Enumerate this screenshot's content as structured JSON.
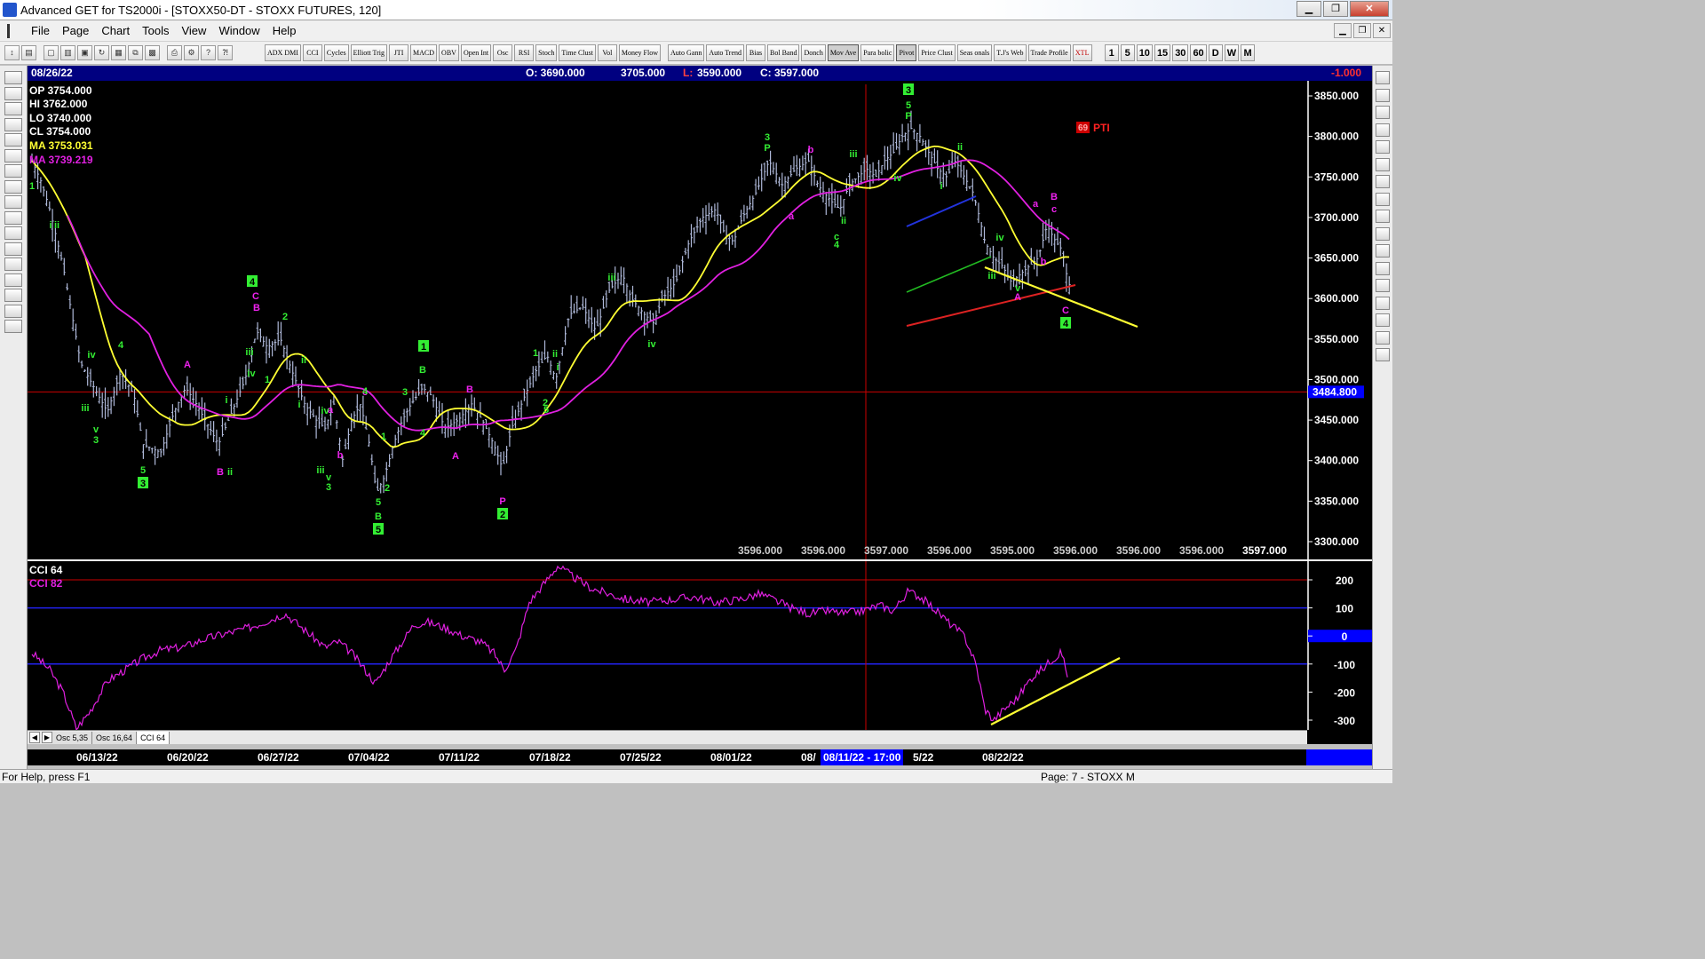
{
  "window": {
    "title": "Advanced GET for TS2000i - [STOXX50-DT - STOXX FUTURES, 120]",
    "buttons": {
      "minimize": "▁",
      "maximize": "❐",
      "close": "✕"
    }
  },
  "menu": {
    "items": [
      "File",
      "Page",
      "Chart",
      "Tools",
      "View",
      "Window",
      "Help"
    ],
    "mdi_buttons": {
      "minimize": "▁",
      "restore": "❐",
      "close": "✕"
    }
  },
  "toolbar": {
    "study_buttons": [
      {
        "label": "ADX DMI"
      },
      {
        "label": "CCI"
      },
      {
        "label": "Cycles"
      },
      {
        "label": "Elliott Trig"
      },
      {
        "label": "JTI"
      },
      {
        "label": "MACD"
      },
      {
        "label": "OBV"
      },
      {
        "label": "Open Int"
      },
      {
        "label": "Osc"
      },
      {
        "label": "RSI"
      },
      {
        "label": "Stoch"
      },
      {
        "label": "Time Clust"
      },
      {
        "label": "Vol"
      },
      {
        "label": "Money Flow"
      }
    ],
    "tool_buttons": [
      {
        "label": "Auto Gann"
      },
      {
        "label": "Auto Trend"
      },
      {
        "label": "Bias"
      },
      {
        "label": "Bol Band"
      },
      {
        "label": "Donch"
      },
      {
        "label": "Mov Ave"
      },
      {
        "label": "Para bolic"
      },
      {
        "label": "Pivot"
      },
      {
        "label": "Price Clust"
      },
      {
        "label": "Seas onals"
      },
      {
        "label": "T.J's Web"
      },
      {
        "label": "Trade Profile"
      },
      {
        "label": "XTL"
      }
    ],
    "interval_buttons": [
      "1",
      "5",
      "10",
      "15",
      "30",
      "60",
      "D",
      "W",
      "M"
    ]
  },
  "chart_header": {
    "date": "08/26/22",
    "open": "O: 3690.000",
    "high": "3705.000",
    "low_label": "L:",
    "low": "3590.000",
    "close": "C: 3597.000",
    "change": "-1.000"
  },
  "info_box": {
    "op": "OP  3754.000",
    "hi": "HI   3762.000",
    "lo": "LO  3740.000",
    "cl": "CL  3754.000",
    "ma1": "MA  3753.031",
    "ma2": "MA  3739.219"
  },
  "pti_label": "PTI",
  "pti_value": "69",
  "cursor_price": "3484.800",
  "price_axis": [
    "3850.000",
    "3800.000",
    "3750.000",
    "3700.000",
    "3650.000",
    "3600.000",
    "3550.000",
    "3500.000",
    "3450.000",
    "3400.000",
    "3350.000",
    "3300.000"
  ],
  "bottom_values": [
    "3596.000",
    "3596.000",
    "3597.000",
    "3596.000",
    "3595.000",
    "3596.000",
    "3596.000",
    "3596.000",
    "3597.000"
  ],
  "cci_panel": {
    "title1": "CCI 64",
    "title2": "CCI  82",
    "axis": [
      "200",
      "100",
      "0",
      "-100",
      "-200",
      "-300"
    ]
  },
  "osc_tabs": [
    "Osc 5,35",
    "Osc 16,64",
    "CCI 64"
  ],
  "date_axis": [
    "06/13/22",
    "06/20/22",
    "06/27/22",
    "07/04/22",
    "07/11/22",
    "07/18/22",
    "07/25/22",
    "08/01/22",
    "08/",
    "5/22",
    "08/22/22"
  ],
  "cursor_date": "08/11/22 - 17:00",
  "status": {
    "help": "For Help, press F1",
    "page": "Page: 7 - STOXX M"
  },
  "colors": {
    "price_bars": "#aeb8d8",
    "ma_fast": "#ffff33",
    "ma_slow": "#e020e0",
    "wave_green": "#33ee33",
    "wave_magenta": "#ee22ee",
    "chart_bg": "#000000",
    "header_bg": "#000080"
  },
  "icons": {
    "left_tools": [
      "file-open-icon",
      "zoom-icon",
      "reset-icon",
      "study-icon",
      "elliott-icon",
      "up-arrow-icon",
      "down-arrow-icon",
      "left-arrow-icon",
      "right-arrow-icon",
      "bars-icon",
      "scale-icon",
      "box-icon",
      "lines-icon",
      "gann-icon",
      "fib-icon",
      "crosshair-icon",
      "print-icon"
    ],
    "right_tools": [
      "pencil-icon",
      "trendline-icon",
      "fib-ret-icon",
      "fib-ext-icon",
      "fib-time-icon",
      "circle-icon",
      "channel-icon",
      "box-icon",
      "pti-icon",
      "grid-icon",
      "mob-icon",
      "text-icon",
      "magnify-icon",
      "erase-icon",
      "pen-icon",
      "copy-icon",
      "undo-icon"
    ]
  }
}
